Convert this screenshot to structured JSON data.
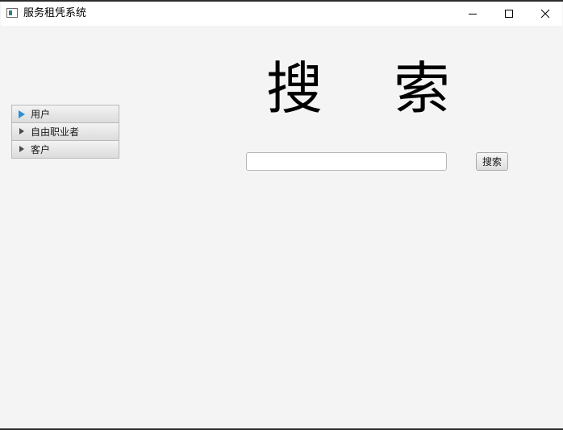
{
  "window": {
    "title": "服务租凭系统",
    "icon": "app-window-icon",
    "controls": {
      "minimize": "minimize-icon",
      "maximize": "maximize-icon",
      "close": "close-icon"
    }
  },
  "sidebar": {
    "items": [
      {
        "label": "用户",
        "expanded": false,
        "active": true
      },
      {
        "label": "自由职业者",
        "expanded": false,
        "active": false
      },
      {
        "label": "客户",
        "expanded": false,
        "active": false
      }
    ]
  },
  "main": {
    "heading_left": "搜",
    "heading_right": "索",
    "search": {
      "value": "",
      "placeholder": ""
    },
    "search_button": "搜索"
  },
  "colors": {
    "background": "#f4f4f4",
    "titlebar": "#ffffff",
    "active_arrow": "#2f8fd0"
  }
}
